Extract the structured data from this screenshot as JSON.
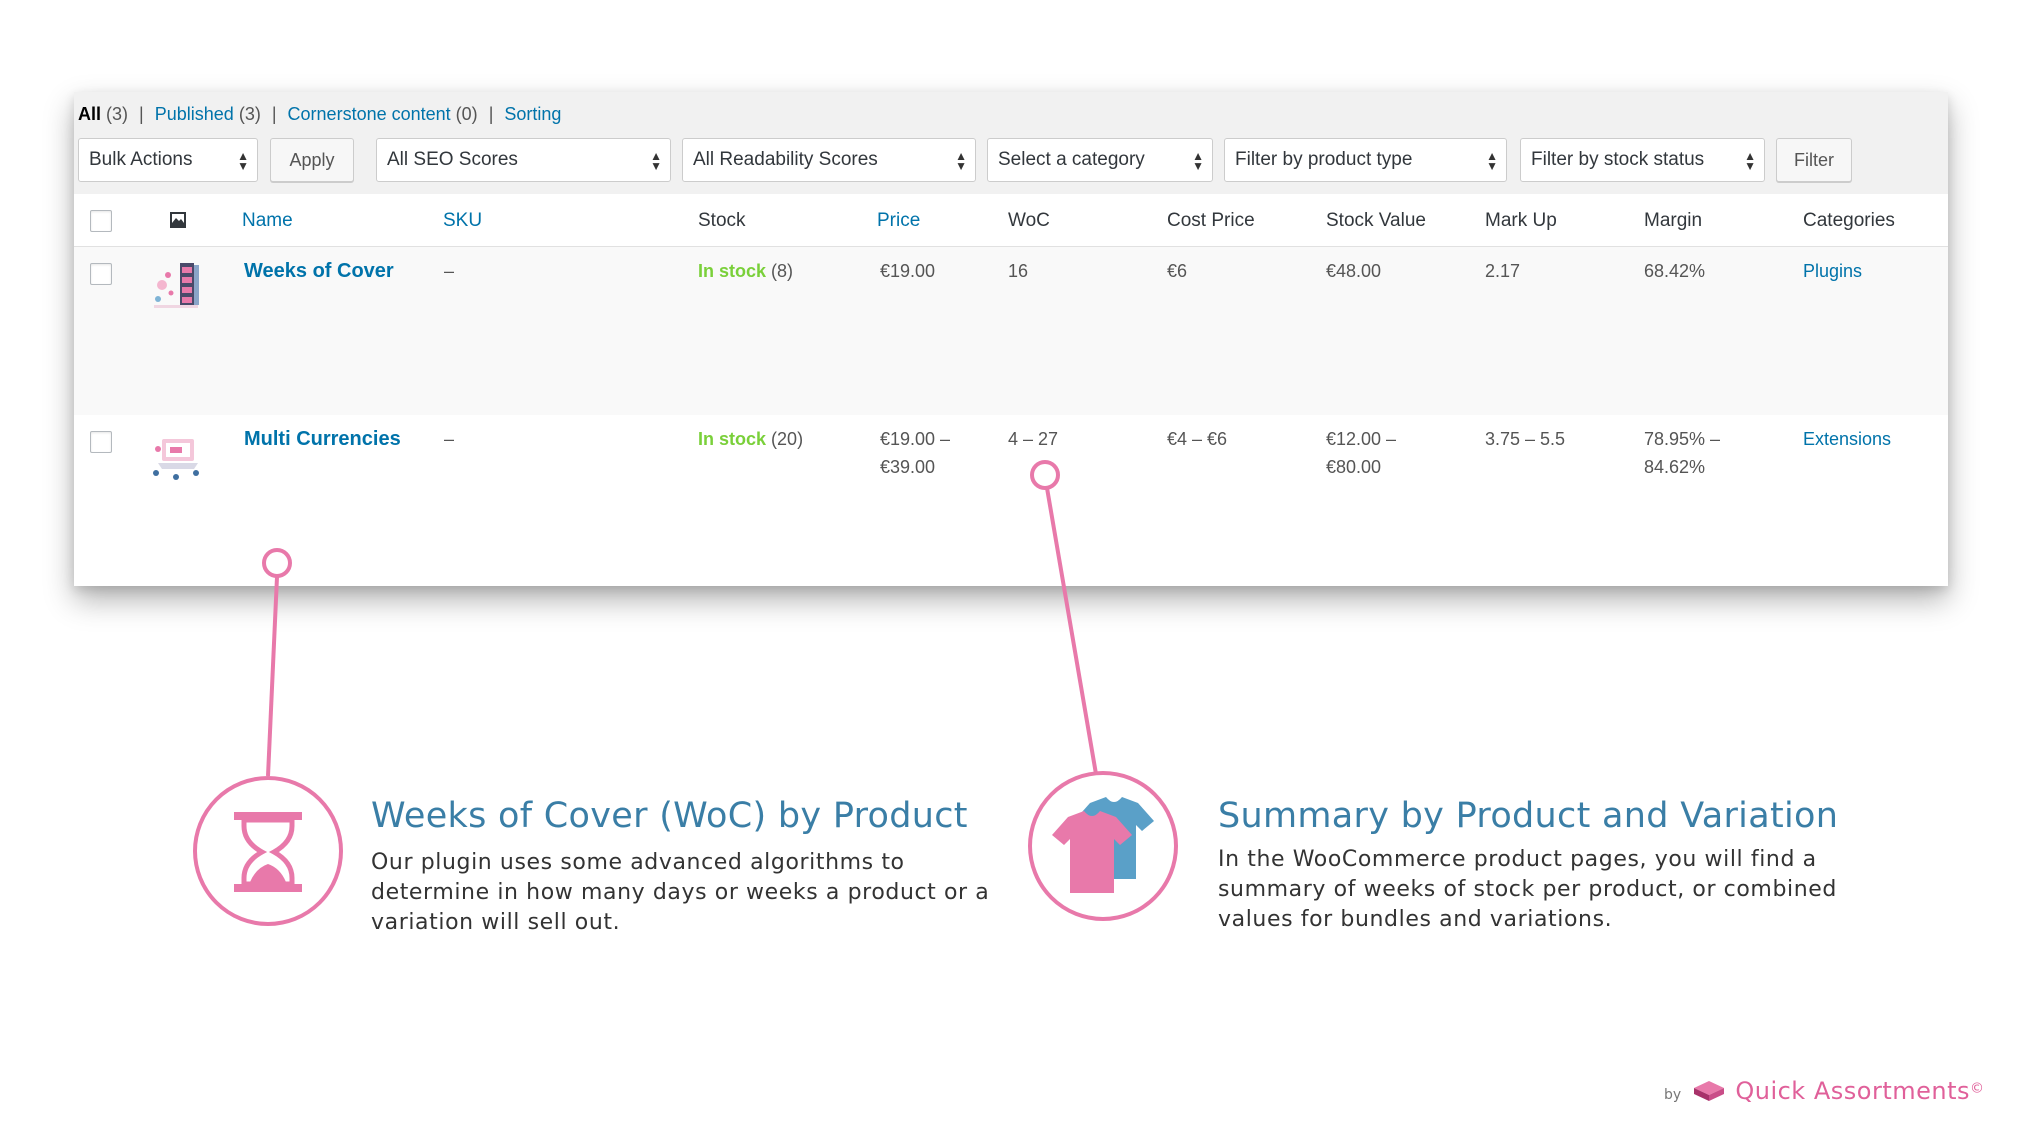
{
  "views": {
    "all": {
      "label": "All",
      "count": "(3)"
    },
    "published": {
      "label": "Published",
      "count": "(3)"
    },
    "cornerstone": {
      "label": "Cornerstone content",
      "count": "(0)"
    },
    "sorting": {
      "label": "Sorting"
    }
  },
  "filters": {
    "bulk_actions": "Bulk Actions",
    "apply": "Apply",
    "seo_scores": "All SEO Scores",
    "readability": "All Readability Scores",
    "category": "Select a category",
    "product_type": "Filter by product type",
    "stock_status": "Filter by stock status",
    "filter_button": "Filter"
  },
  "columns": {
    "name": "Name",
    "sku": "SKU",
    "stock": "Stock",
    "price": "Price",
    "woc": "WoC",
    "cost_price": "Cost Price",
    "stock_value": "Stock Value",
    "mark_up": "Mark Up",
    "margin": "Margin",
    "categories": "Categories"
  },
  "products": [
    {
      "name": "Weeks of Cover",
      "sku": "–",
      "stock_status": "In stock",
      "stock_qty": "(8)",
      "price_1": "€19.00",
      "price_2": "",
      "woc": "16",
      "cost_price": "€6",
      "stock_value_1": "€48.00",
      "stock_value_2": "",
      "mark_up": "2.17",
      "margin_1": "68.42%",
      "margin_2": "",
      "category": "Plugins"
    },
    {
      "name": "Multi Currencies",
      "sku": "–",
      "stock_status": "In stock",
      "stock_qty": "(20)",
      "price_1": "€19.00 –",
      "price_2": "€39.00",
      "woc": "4 – 27",
      "cost_price": "€4 – €6",
      "stock_value_1": "€12.00 –",
      "stock_value_2": "€80.00",
      "mark_up": "3.75 – 5.5",
      "margin_1": "78.95% –",
      "margin_2": "84.62%",
      "category": "Extensions"
    }
  ],
  "features": [
    {
      "title": "Weeks of Cover (WoC) by Product",
      "lines": [
        "Our plugin uses some advanced algorithms to",
        "determine in how many days or weeks a product or a",
        "variation will sell out."
      ],
      "icon": "hourglass-icon"
    },
    {
      "title": "Summary by Product and Variation",
      "lines": [
        "In the WooCommerce product pages, you will find a",
        "summary of weeks of stock per product, or combined",
        "values for bundles and variations."
      ],
      "icon": "tshirt-icon"
    }
  ],
  "brand": {
    "by": "by",
    "name": "Quick Assortments",
    "mark": "©"
  },
  "colors": {
    "accent_pink": "#e879aa",
    "title_blue": "#3a7ea6",
    "link": "#0073aa",
    "in_stock": "#7ad03a"
  }
}
